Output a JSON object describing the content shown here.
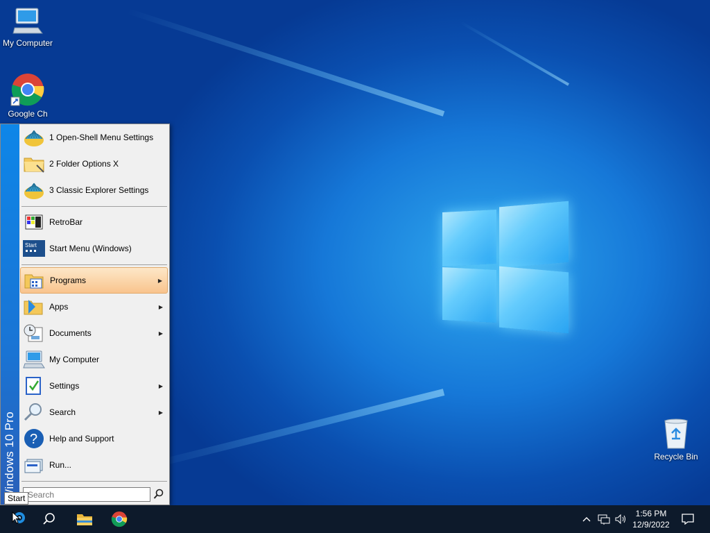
{
  "desktop": {
    "icons": [
      {
        "label": "My Computer",
        "icon": "computer-icon"
      },
      {
        "label": "Google Ch",
        "icon": "chrome-icon"
      },
      {
        "label": "Recycle Bin",
        "icon": "recycle-bin-icon"
      }
    ]
  },
  "start_menu": {
    "banner": "Windows 10 Pro",
    "pinned": [
      {
        "label": "1 Open-Shell Menu Settings",
        "icon": "open-shell-icon"
      },
      {
        "label": "2 Folder Options X",
        "icon": "folder-options-icon"
      },
      {
        "label": "3 Classic Explorer Settings",
        "icon": "open-shell-icon"
      }
    ],
    "recent": [
      {
        "label": "RetroBar",
        "icon": "retrobar-icon"
      },
      {
        "label": "Start Menu (Windows)",
        "icon": "start-menu-icon"
      }
    ],
    "main": [
      {
        "label": "Programs",
        "icon": "programs-icon",
        "submenu": true,
        "highlighted": true
      },
      {
        "label": "Apps",
        "icon": "apps-icon",
        "submenu": true
      },
      {
        "label": "Documents",
        "icon": "documents-icon",
        "submenu": true
      },
      {
        "label": "My Computer",
        "icon": "computer-icon",
        "submenu": false
      },
      {
        "label": "Settings",
        "icon": "settings-icon",
        "submenu": true
      },
      {
        "label": "Search",
        "icon": "search-icon",
        "submenu": true
      },
      {
        "label": "Help and Support",
        "icon": "help-icon",
        "submenu": false
      },
      {
        "label": "Run...",
        "icon": "run-icon",
        "submenu": false
      }
    ],
    "search_placeholder": "Search",
    "submenu_arrow": "▶"
  },
  "tooltip": "Start",
  "taskbar": {
    "buttons": [
      "start-button",
      "search-button",
      "file-explorer-button",
      "chrome-button"
    ],
    "tray_chevron": "^",
    "clock_time": "1:56 PM",
    "clock_date": "12/9/2022"
  },
  "colors": {
    "accent": "#1a74d4",
    "highlight": "#f9c48d",
    "taskbar": "#0d1a2b"
  }
}
